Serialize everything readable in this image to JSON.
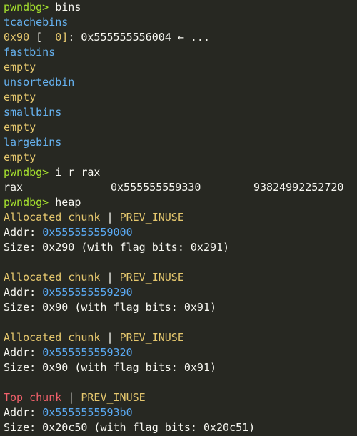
{
  "terminal": {
    "prompt": "pwndbg>",
    "cmd_bins": " bins",
    "tcache_label": "tcachebins",
    "tcache_entry": {
      "size": "0x90",
      "count_open": " [  ",
      "count": "0]",
      "colon_addr": ": 0x555555556004",
      "arrow": " ← ..."
    },
    "fastbins_label": "fastbins",
    "fastbins_value": "empty",
    "unsorted_label": "unsortedbin",
    "unsorted_value": "empty",
    "small_label": "smallbins",
    "small_value": "empty",
    "large_label": "largebins",
    "large_value": "empty",
    "cmd_ir": " i r rax",
    "register": {
      "name": "rax",
      "hex": "0x555555559330",
      "dec": "93824992252720"
    },
    "cmd_heap": " heap",
    "chunks": [
      {
        "type": "Allocated chunk",
        "sep": " | ",
        "flag": "PREV_INUSE",
        "addr_label": "Addr: ",
        "addr": "0x555555559000",
        "size_text": "Size: 0x290 (with flag bits: 0x291)"
      },
      {
        "type": "Allocated chunk",
        "sep": " | ",
        "flag": "PREV_INUSE",
        "addr_label": "Addr: ",
        "addr": "0x555555559290",
        "size_text": "Size: 0x90 (with flag bits: 0x91)"
      },
      {
        "type": "Allocated chunk",
        "sep": " | ",
        "flag": "PREV_INUSE",
        "addr_label": "Addr: ",
        "addr": "0x555555559320",
        "size_text": "Size: 0x90 (with flag bits: 0x91)"
      },
      {
        "type": "Top chunk",
        "sep": " | ",
        "flag": "PREV_INUSE",
        "addr_label": "Addr: ",
        "addr": "0x5555555593b0",
        "size_text": "Size: 0x20c50 (with flag bits: 0x20c51)"
      }
    ]
  }
}
